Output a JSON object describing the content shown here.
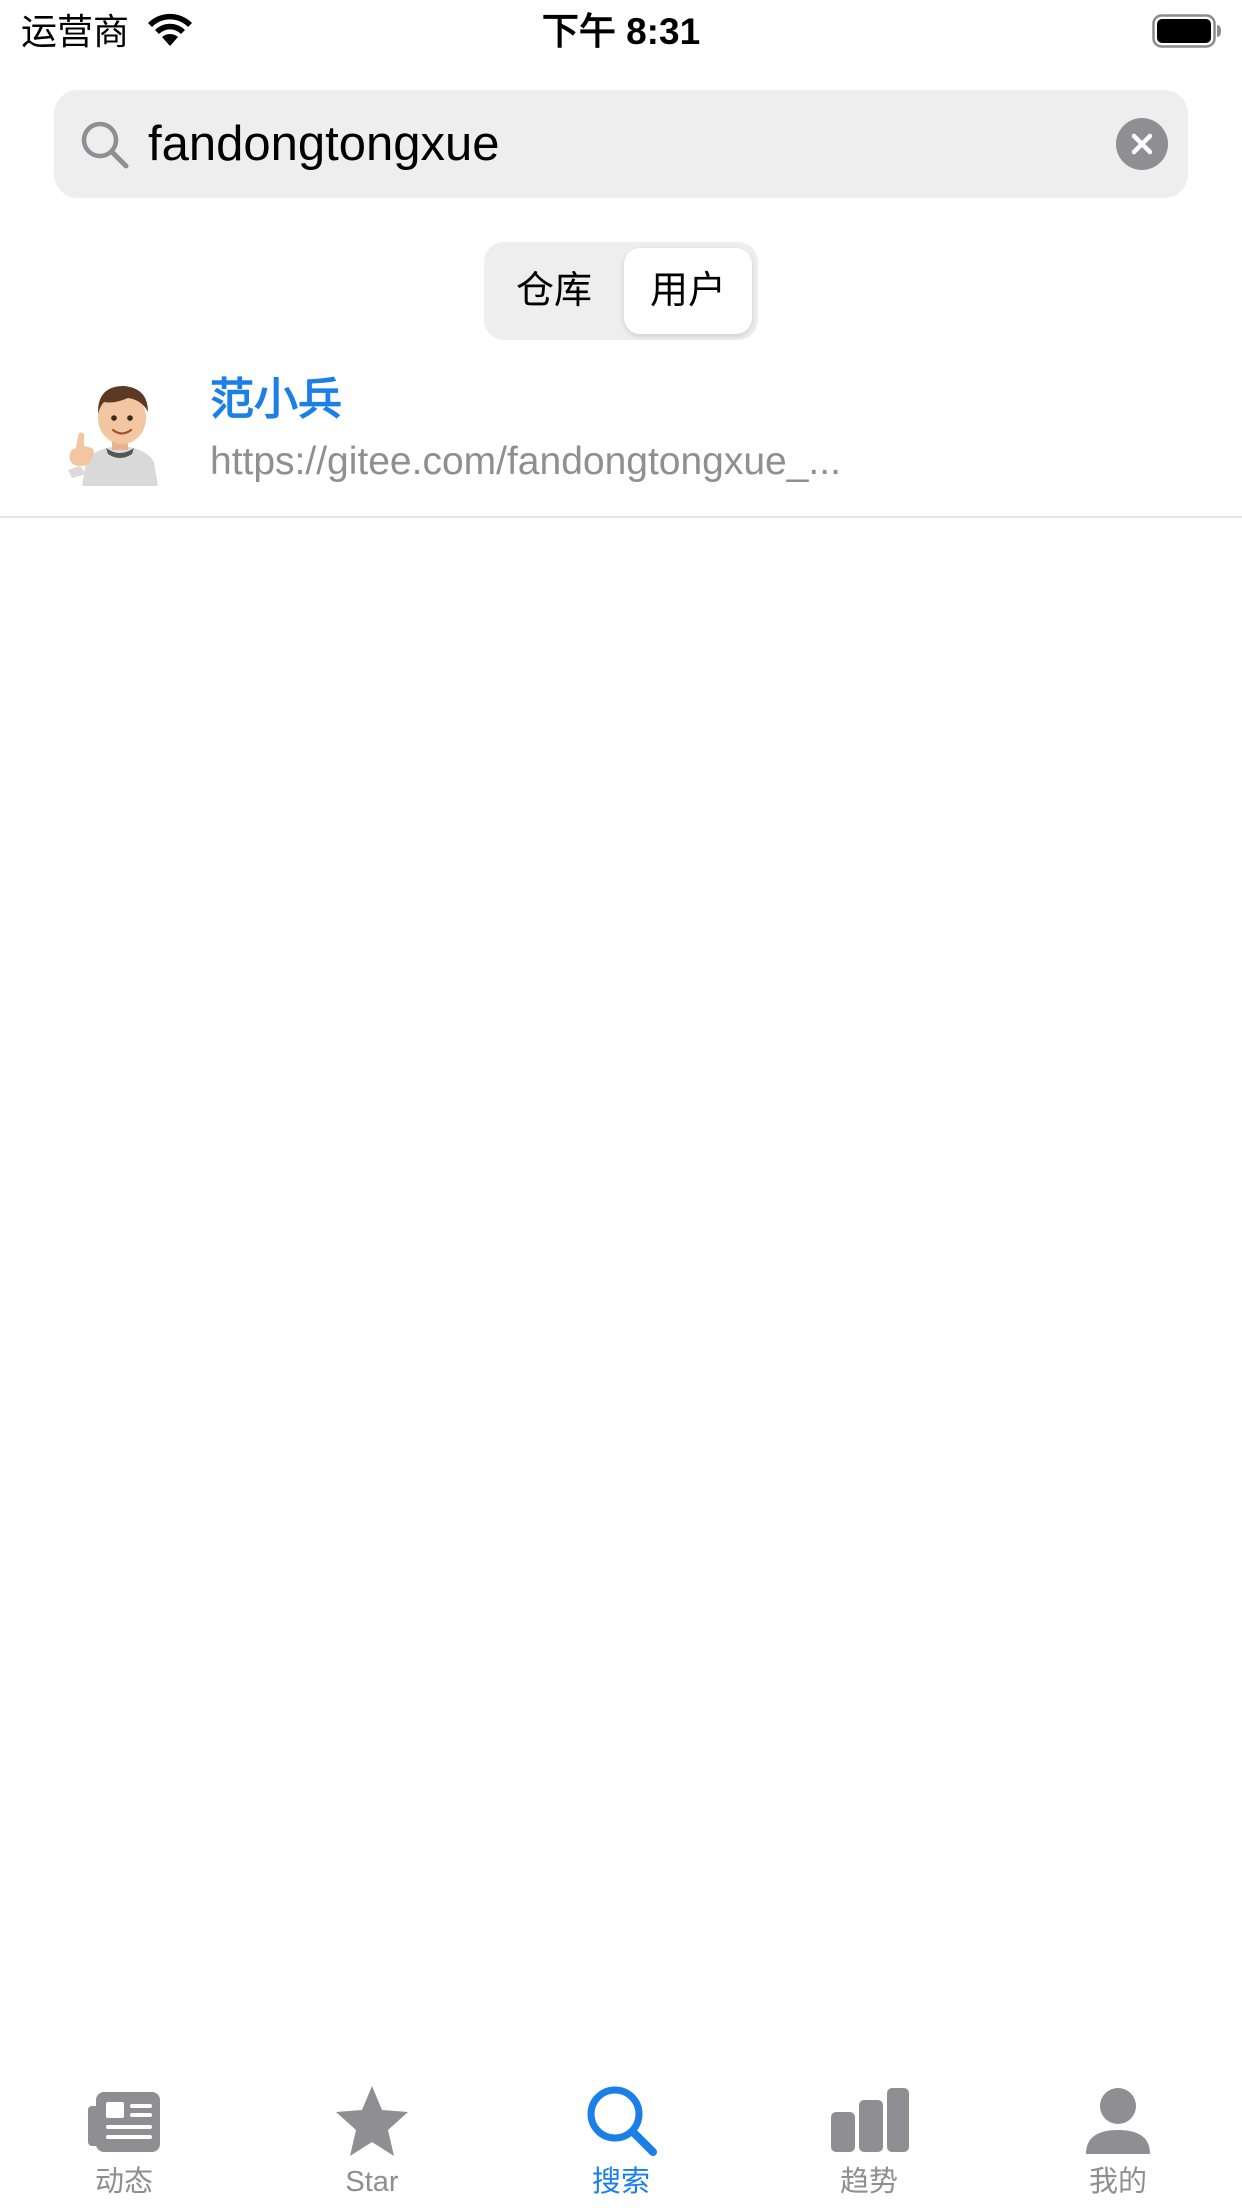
{
  "status_bar": {
    "carrier": "运营商",
    "time": "下午 8:31"
  },
  "search": {
    "value": "fandongtongxue",
    "icon": "search-icon",
    "clear_icon": "clear-icon"
  },
  "segmented": {
    "options": [
      "仓库",
      "用户"
    ],
    "selected": "用户"
  },
  "results": [
    {
      "name": "范小兵",
      "url": "https://gitee.com/fandongtongxue_..."
    }
  ],
  "tab_bar": {
    "tabs": [
      {
        "label": "动态",
        "icon": "news-icon",
        "active": false
      },
      {
        "label": "Star",
        "icon": "star-icon",
        "active": false
      },
      {
        "label": "搜索",
        "icon": "search-icon",
        "active": true
      },
      {
        "label": "趋势",
        "icon": "bar-chart-icon",
        "active": false
      },
      {
        "label": "我的",
        "icon": "person-icon",
        "active": false
      }
    ]
  },
  "colors": {
    "accent": "#1a7fe6",
    "inactive": "#8e8e93",
    "search_bg": "#eeeeef"
  }
}
